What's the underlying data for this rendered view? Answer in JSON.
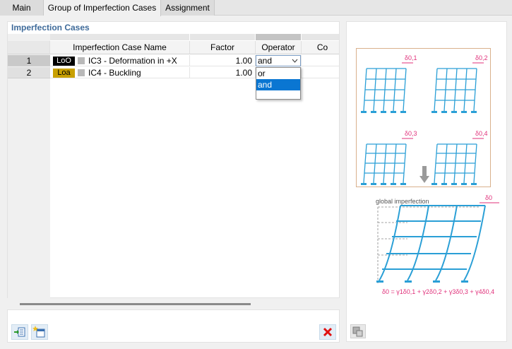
{
  "tabs": [
    {
      "label": "Main",
      "active": false
    },
    {
      "label": "Group of Imperfection Cases",
      "active": true
    },
    {
      "label": "Assignment",
      "active": false
    }
  ],
  "section_title": "Imperfection Cases",
  "columns": {
    "name": "Imperfection Case Name",
    "factor": "Factor",
    "operator": "Operator",
    "comment_partial": "Co"
  },
  "rows": [
    {
      "num": "1",
      "tag": "LoO",
      "tag_color": "#000000",
      "tag_text_color": "#ffffff",
      "name": "IC3 - Deformation in +X",
      "factor": "1.00",
      "operator": "and"
    },
    {
      "num": "2",
      "tag": "Loa",
      "tag_color": "#c8a000",
      "tag_text_color": "#000000",
      "name": "IC4 - Buckling",
      "factor": "1.00",
      "operator": ""
    }
  ],
  "operator_dropdown": {
    "current": "and",
    "options": [
      "or",
      "and"
    ],
    "selected": "and"
  },
  "figure": {
    "top_labels": [
      "δ0,1",
      "δ0,2",
      "δ0,3",
      "δ0,4"
    ],
    "global_label": "global imperfection",
    "delta_label": "δ0",
    "formula": "δ0 = γ1δ0,1 + γ2δ0,2 + γ3δ0,3 + γ4δ0,4"
  },
  "colors": {
    "accent": "#3f6b9a",
    "selection": "#0a76d2",
    "structure": "#2a9fd6",
    "dimension": "#e0307a",
    "delete": "#e01010"
  },
  "icons": [
    "import-icon",
    "new-item-icon",
    "delete-icon",
    "figure-settings-icon"
  ]
}
